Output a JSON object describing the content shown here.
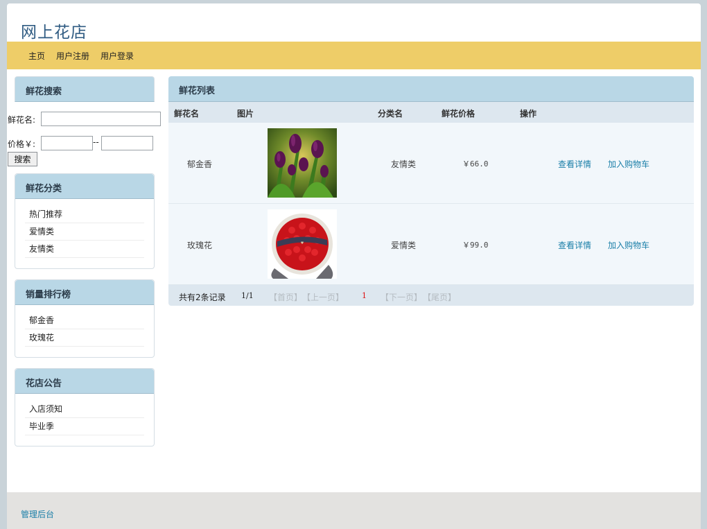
{
  "site": {
    "title": "网上花店"
  },
  "nav": {
    "items": [
      "主页",
      "用户注册",
      "用户登录"
    ]
  },
  "search": {
    "title": "鲜花搜索",
    "name_label": "鲜花名:",
    "name_value": "",
    "price_label": "价格￥:",
    "price_separator": "--",
    "price_from": "",
    "price_to": "",
    "button_label": "搜索"
  },
  "categories": {
    "title": "鲜花分类",
    "items": [
      "热门推荐",
      "爱情类",
      "友情类"
    ]
  },
  "ranking": {
    "title": "销量排行榜",
    "items": [
      "郁金香",
      "玫瑰花"
    ]
  },
  "notices": {
    "title": "花店公告",
    "items": [
      "入店须知",
      "毕业季"
    ]
  },
  "main": {
    "title": "鲜花列表",
    "columns": [
      "鲜花名",
      "图片",
      "分类名",
      "鲜花价格",
      "操作"
    ],
    "rows": [
      {
        "name": "郁金香",
        "image": "tulip-photo",
        "category": "友情类",
        "price": "￥66.0",
        "detail": "查看详情",
        "cart": "加入购物车"
      },
      {
        "name": "玫瑰花",
        "image": "rose-bouquet-photo",
        "category": "爱情类",
        "price": "￥99.0",
        "detail": "查看详情",
        "cart": "加入购物车"
      }
    ],
    "pager": {
      "total": "共有2条记录",
      "pages": "1/1",
      "first": "【首页】",
      "prev": "【上一页】",
      "current": "1",
      "next": "【下一页】",
      "last": "【尾页】"
    }
  },
  "footer": {
    "admin_link": "管理后台"
  }
}
